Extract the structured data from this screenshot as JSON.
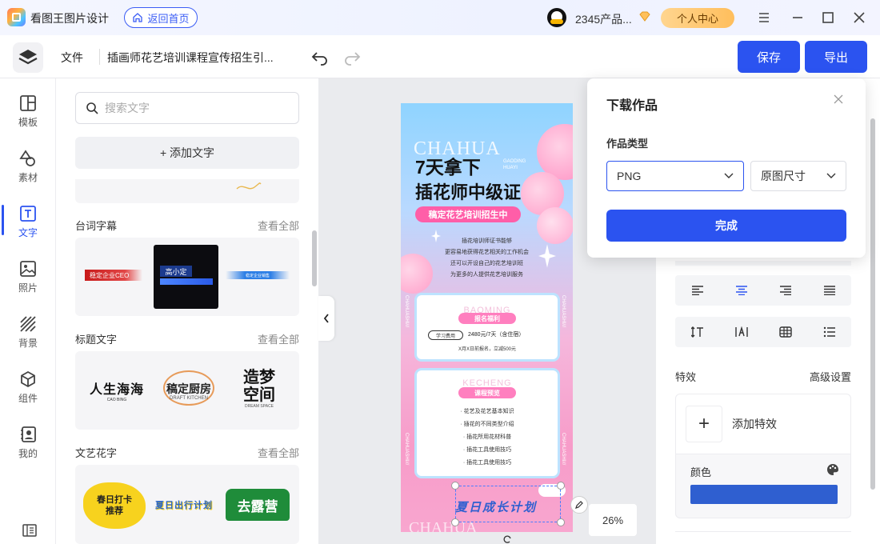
{
  "app": {
    "name": "看图王图片设计",
    "home_label": "返回首页",
    "user_name": "2345产品...",
    "center_label": "个人中心"
  },
  "toolbar": {
    "file_label": "文件",
    "doc_title": "插画师花艺培训课程宣传招生引...",
    "save_label": "保存",
    "export_label": "导出"
  },
  "rail": {
    "items": [
      {
        "label": "模板",
        "icon": "template-icon"
      },
      {
        "label": "素材",
        "icon": "shapes-icon"
      },
      {
        "label": "文字",
        "icon": "text-icon"
      },
      {
        "label": "照片",
        "icon": "photo-icon"
      },
      {
        "label": "背景",
        "icon": "background-icon"
      },
      {
        "label": "组件",
        "icon": "component-icon"
      },
      {
        "label": "我的",
        "icon": "my-icon"
      }
    ]
  },
  "panel": {
    "search_placeholder": "搜索文字",
    "add_text_label": "+ 添加文字",
    "sections": [
      {
        "title": "台词字幕",
        "more": "查看全部",
        "samples": [
          "稳定企业CEO",
          "高小定",
          "稳定企业销售"
        ]
      },
      {
        "title": "标题文字",
        "more": "查看全部",
        "samples": [
          "人生海海",
          "稿定厨房",
          "造梦空间"
        ],
        "subs": [
          "CAO BING",
          "DRAFT KITCHEN",
          "DREAM SPACE"
        ]
      },
      {
        "title": "文艺花字",
        "more": "查看全部",
        "samples": [
          "春日打卡推荐",
          "夏日出行计划",
          "去露营"
        ]
      }
    ]
  },
  "poster": {
    "watermark": "CHAHUA",
    "sub1": "GAODING",
    "sub2": "HUAYI",
    "headline1": "7天拿下",
    "headline2": "插花师中级证",
    "tag": "稿定花艺培训招生中",
    "intro": [
      "插花培训师证书能够",
      "更容易地获得花艺相关的工作机会",
      "还可以开设自己的花艺培训班",
      "为更多的人提供花艺培训服务"
    ],
    "card1_watermark": "BAOMING",
    "card1_title": "报名福利",
    "card1_pill": "学习费用",
    "card1_price": "2480元/7天（含住宿）",
    "card1_note": "X月X日前报名，立减500元",
    "card2_watermark": "KECHENG",
    "card2_title": "课程预览",
    "course_items": [
      "· 花艺及花艺基本知识",
      "· 插花的不同类型介绍",
      "· 插花所用花材科普",
      "· 插花工具使用技巧",
      "· 插花工具使用技巧"
    ],
    "side_text": "CHAHUASHI///",
    "bottom_text": "夏日成长计划"
  },
  "canvas": {
    "zoom": "26%"
  },
  "right": {
    "fx_label": "特效",
    "fx_advanced": "高级设置",
    "add_fx_label": "添加特效",
    "color_label": "颜色",
    "color_value": "#2f5fd0"
  },
  "popup": {
    "title": "下载作品",
    "type_label": "作品类型",
    "format": "PNG",
    "size": "原图尺寸",
    "confirm": "完成"
  }
}
